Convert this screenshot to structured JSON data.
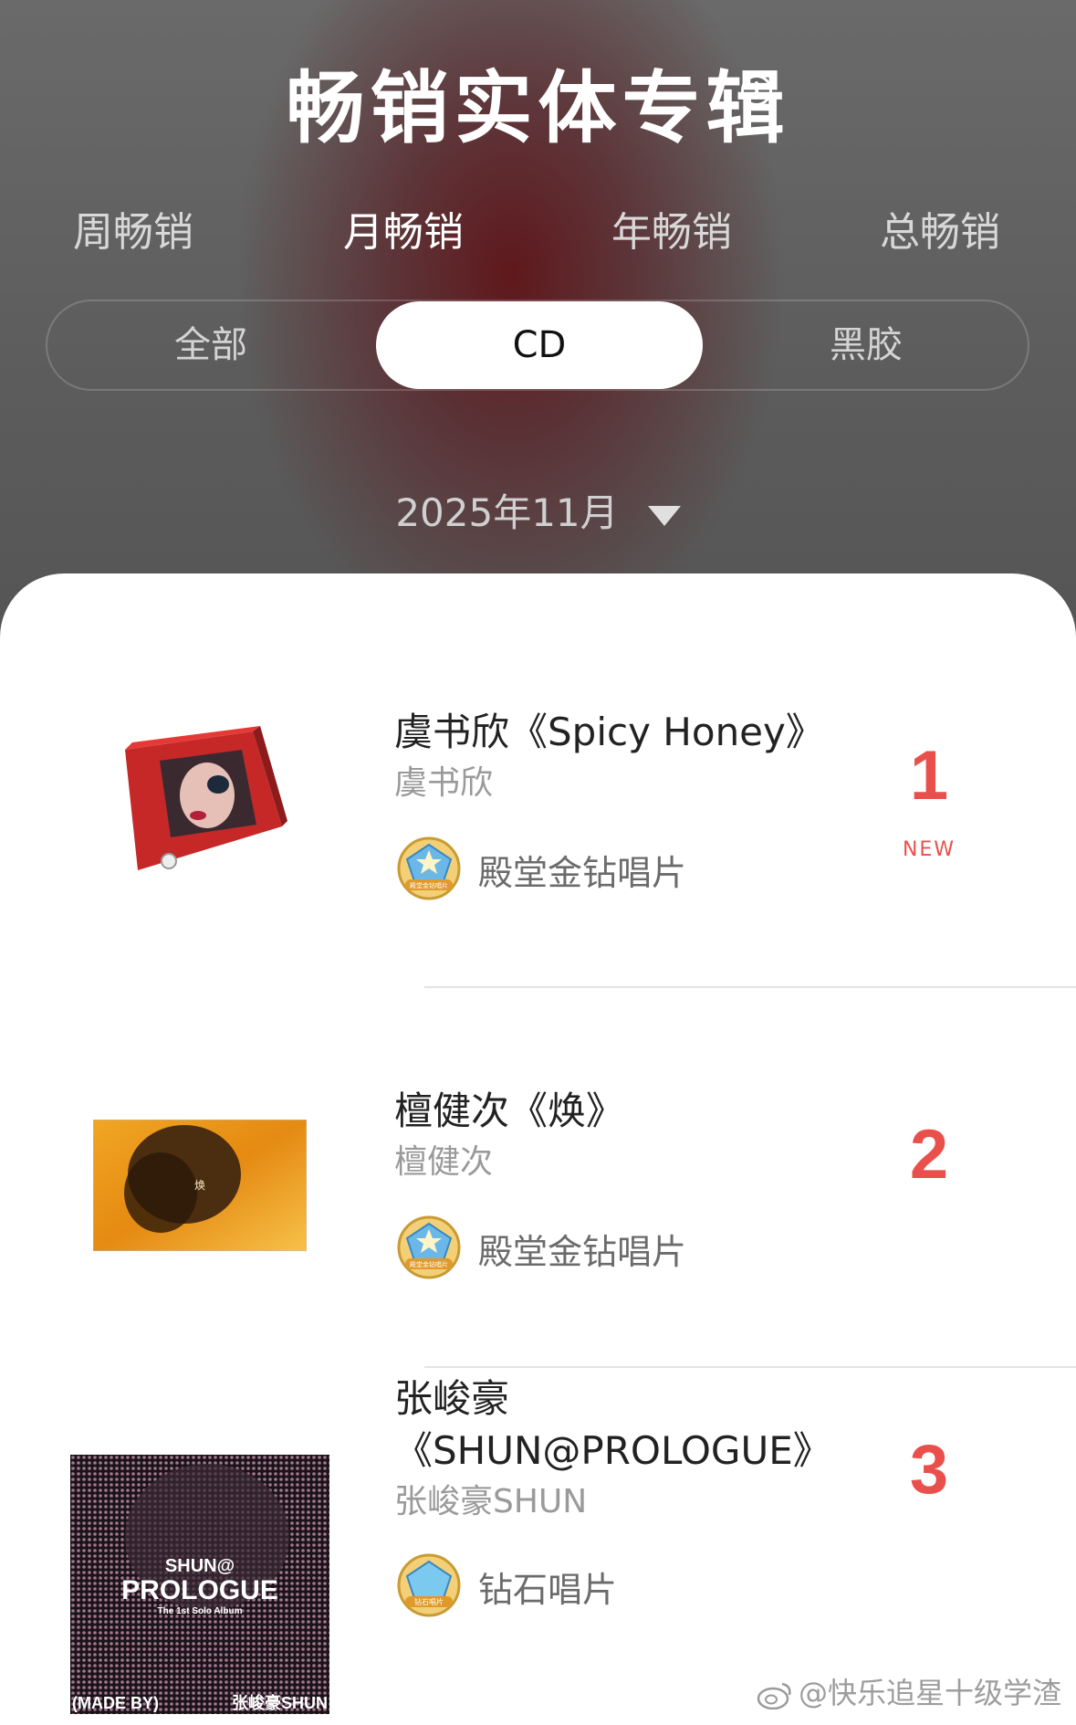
{
  "header": {
    "title": "畅销实体专辑",
    "info_icon": "info-icon"
  },
  "period_tabs": [
    {
      "label": "周畅销",
      "active": false
    },
    {
      "label": "月畅销",
      "active": true
    },
    {
      "label": "年畅销",
      "active": false
    },
    {
      "label": "总畅销",
      "active": false
    }
  ],
  "format_tabs": [
    {
      "label": "全部",
      "active": false
    },
    {
      "label": "CD",
      "active": true
    },
    {
      "label": "黑胶",
      "active": false
    }
  ],
  "date_selector": {
    "value": "2025年11月",
    "icon": "caret-down-icon"
  },
  "albums": [
    {
      "title": "虞书欣《Spicy Honey》",
      "artist": "虞书欣",
      "certification": "殿堂金钻唱片",
      "badge_text": "殿堂金钻唱片",
      "rank": "1",
      "tag": "NEW"
    },
    {
      "title": "檀健次《焕》",
      "artist": "檀健次",
      "certification": "殿堂金钻唱片",
      "badge_text": "殿堂金钻唱片",
      "rank": "2",
      "cover_mark": "焕"
    },
    {
      "title_line1": "张峻豪",
      "title_line2": "《SHUN@PROLOGUE》",
      "artist": "张峻豪SHUN",
      "certification": "钻石唱片",
      "badge_text": "钻石唱片",
      "rank": "3",
      "cover": {
        "line1": "SHUN@",
        "line2": "PROLOGUE",
        "line3": "The 1st Solo Album",
        "footer_left": "(MADE BY)",
        "footer_right": "张峻豪SHUN"
      }
    }
  ],
  "watermark": "@快乐追星十级学渣",
  "colors": {
    "rank_red": "#e9504c",
    "header_bg": "#5a5a5a",
    "active_pill": "#ffffff"
  }
}
